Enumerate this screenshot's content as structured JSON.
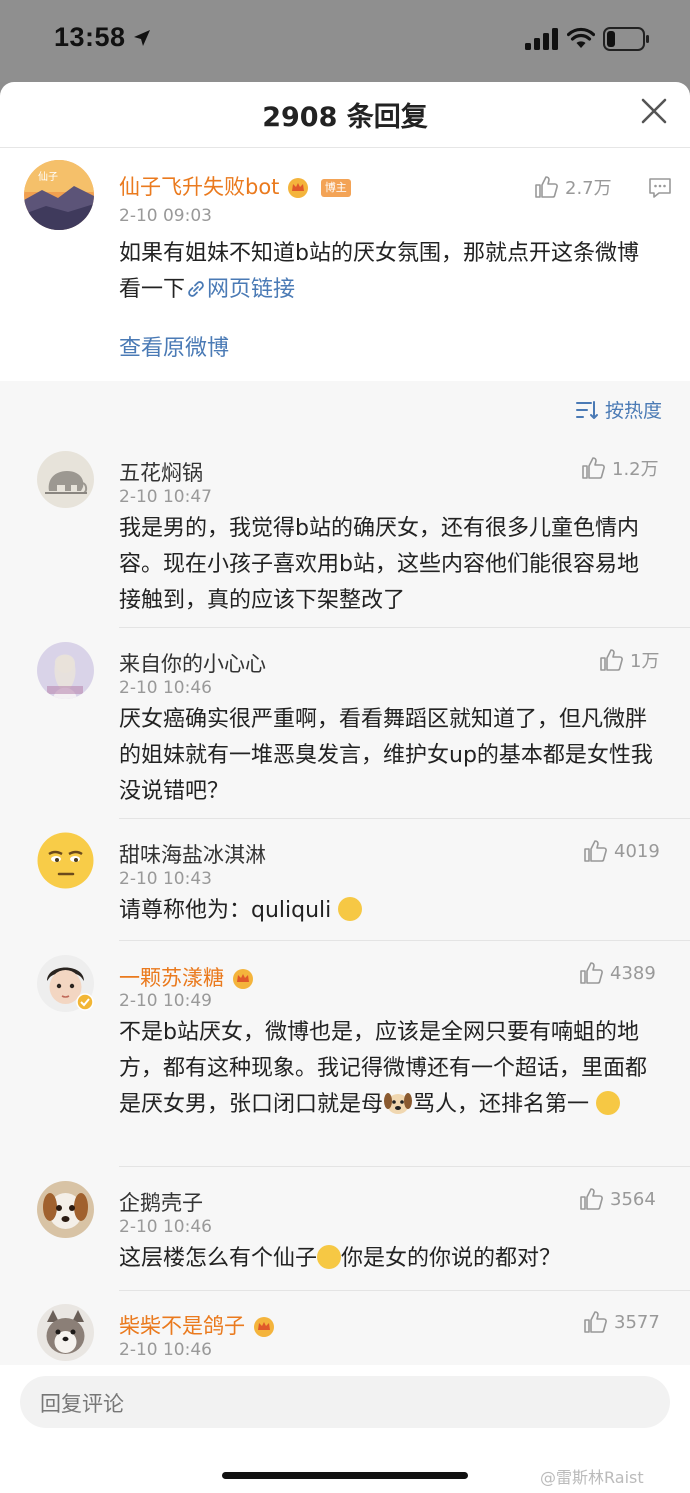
{
  "status_bar": {
    "time": "13:58"
  },
  "sheet": {
    "title": "2908 条回复"
  },
  "original_post": {
    "username": "仙子飞升失败bot",
    "badge": "博主",
    "time": "2-10 09:03",
    "likes": "2.7万",
    "text": "如果有姐妹不知道b站的厌女氛围，那就点开这条微博看一下",
    "link_text": "网页链接",
    "view_original": "查看原微博"
  },
  "sort": {
    "label": "按热度"
  },
  "replies": [
    {
      "username": "五花焖锅",
      "time": "2-10 10:47",
      "likes": "1.2万",
      "text": "我是男的，我觉得b站的确厌女，还有很多儿童色情内容。现在小孩子喜欢用b站，这些内容他们能很容易地接触到，真的应该下架整改了"
    },
    {
      "username": "来自你的小心心",
      "time": "2-10 10:46",
      "likes": "1万",
      "text": "厌女癌确实很严重啊，看看舞蹈区就知道了，但凡微胖的姐妹就有一堆恶臭发言，维护女up的基本都是女性我没说错吧？"
    },
    {
      "username": "甜味海盐冰淇淋",
      "time": "2-10 10:43",
      "likes": "4019",
      "text": "请尊称他为：quliquli"
    },
    {
      "username": "一颗苏漾糖",
      "time": "2-10 10:49",
      "likes": "4389",
      "text_a": "不是b站厌女，微博也是，应该是全网只要有喃蛆的地方，都有这种现象。我记得微博还有一个超话，里面都是厌女男，张口闭口就是母",
      "text_b": "骂人，还排名第一"
    },
    {
      "username": "企鹅壳子",
      "time": "2-10 10:46",
      "likes": "3564",
      "text_a": "这层楼怎么有个仙子",
      "text_b": "你是女的你说的都对？"
    },
    {
      "username": "柴柴不是鸽子",
      "time": "2-10 10:46",
      "likes": "3577"
    }
  ],
  "input": {
    "placeholder": "回复评论"
  },
  "watermark": "@雷斯林Raist",
  "colors": {
    "accent_link": "#4a7ab5",
    "vip_name": "#ea7a1e",
    "meta_gray": "#999999"
  }
}
